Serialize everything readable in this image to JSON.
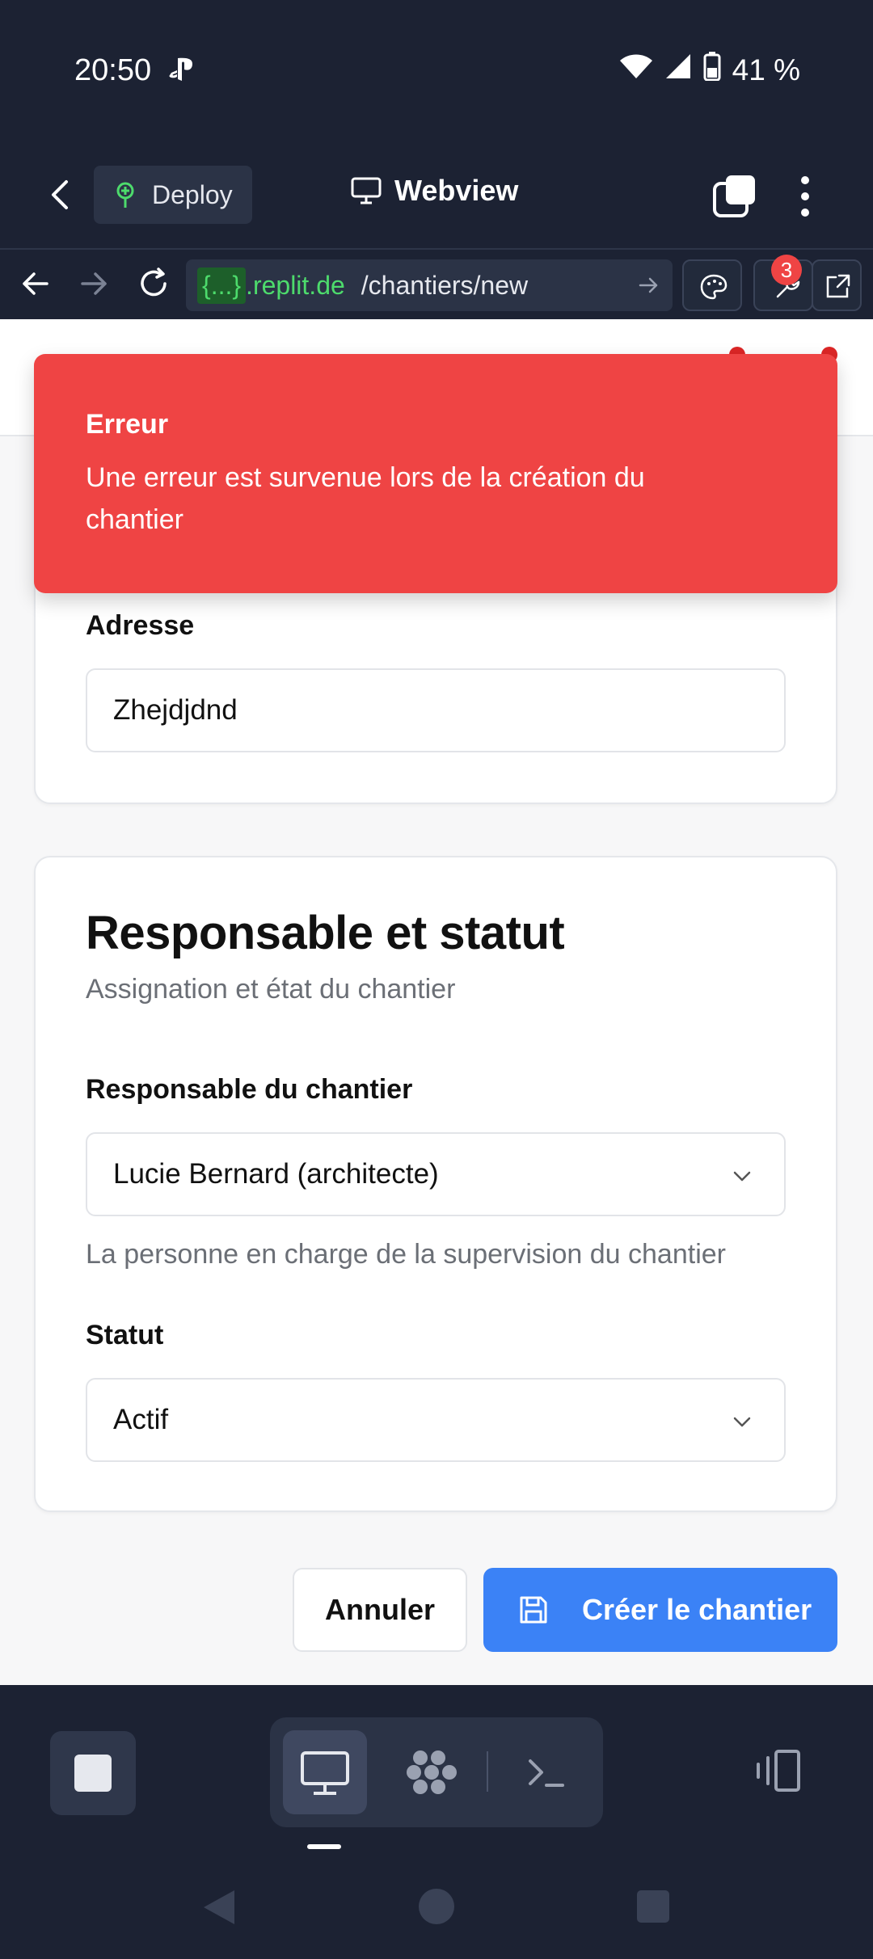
{
  "status_bar": {
    "time": "20:50",
    "battery": "41 %"
  },
  "header": {
    "deploy_label": "Deploy",
    "title": "Webview"
  },
  "url_bar": {
    "host_tag": "{...}",
    "host": ".replit.de",
    "path": "/chantiers/new",
    "badge_count": "3"
  },
  "toast": {
    "title": "Erreur",
    "message": "Une erreur est survenue lors de la création du chantier"
  },
  "form": {
    "address_label": "Adresse",
    "address_value": "Zhejdjdnd",
    "section_title": "Responsable et statut",
    "section_subtitle": "Assignation et état du chantier",
    "manager_label": "Responsable du chantier",
    "manager_value": "Lucie Bernard (architecte)",
    "manager_help": "La personne en charge de la supervision du chantier",
    "status_label": "Statut",
    "status_value": "Actif"
  },
  "actions": {
    "cancel_label": "Annuler",
    "create_label": "Créer le chantier"
  },
  "colors": {
    "accent": "#3b82f6",
    "error": "#ef4444",
    "chrome": "#1c2233",
    "url_green": "#4ddb6c"
  }
}
